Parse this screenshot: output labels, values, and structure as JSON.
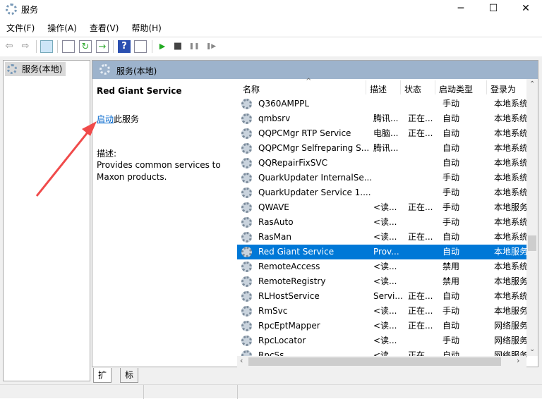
{
  "window": {
    "title": "服务",
    "minimize": "─",
    "maximize": "☐",
    "close": "✕"
  },
  "menu": [
    "文件(F)",
    "操作(A)",
    "查看(V)",
    "帮助(H)"
  ],
  "toolbar": {
    "back": "⇦",
    "forward": "⇨",
    "help": "?",
    "play": "▶",
    "stop": "■",
    "pause": "❚❚",
    "resume": "❚▶"
  },
  "tree": {
    "item": "服务(本地)"
  },
  "panel": {
    "header": "服务(本地)",
    "service_name": "Red Giant Service",
    "start_link": "启动",
    "start_suffix": "此服务",
    "desc_label": "描述:",
    "desc_text": "Provides common services to Maxon products."
  },
  "columns": [
    "名称",
    "描述",
    "状态",
    "启动类型",
    "登录为"
  ],
  "rows": [
    [
      "Q360AMPPL",
      "",
      "",
      "手动",
      "本地系统"
    ],
    [
      "qmbsrv",
      "腾讯...",
      "正在...",
      "自动",
      "本地系统"
    ],
    [
      "QQPCMgr RTP Service",
      "电脑...",
      "正在...",
      "自动",
      "本地系统"
    ],
    [
      "QQPCMgr Selfreparing S...",
      "腾讯...",
      "",
      "自动",
      "本地系统"
    ],
    [
      "QQRepairFixSVC",
      "",
      "",
      "自动",
      "本地系统"
    ],
    [
      "QuarkUpdater InternalSe...",
      "",
      "",
      "手动",
      "本地系统"
    ],
    [
      "QuarkUpdater Service 1....",
      "",
      "",
      "手动",
      "本地系统"
    ],
    [
      "QWAVE",
      "<读...",
      "正在...",
      "手动",
      "本地服务"
    ],
    [
      "RasAuto",
      "<读...",
      "",
      "手动",
      "本地系统"
    ],
    [
      "RasMan",
      "<读...",
      "正在...",
      "自动",
      "本地系统"
    ],
    [
      "Red Giant Service",
      "Prov...",
      "",
      "自动",
      "本地服务"
    ],
    [
      "RemoteAccess",
      "<读...",
      "",
      "禁用",
      "本地系统"
    ],
    [
      "RemoteRegistry",
      "<读...",
      "",
      "禁用",
      "本地服务"
    ],
    [
      "RLHostService",
      "Servi...",
      "正在...",
      "自动",
      "本地系统"
    ],
    [
      "RmSvc",
      "<读...",
      "正在...",
      "手动",
      "本地服务"
    ],
    [
      "RpcEptMapper",
      "<读...",
      "正在...",
      "自动",
      "网络服务"
    ],
    [
      "RpcLocator",
      "<读...",
      "",
      "手动",
      "网络服务"
    ],
    [
      "RpcSs",
      "<读...",
      "正在...",
      "自动",
      "网络服务"
    ]
  ],
  "selected_row": 10,
  "tabs": [
    "扩展",
    "标准"
  ],
  "colors": {
    "selection": "#0078d7",
    "header": "#9db3cc",
    "arrow": "#f04a4a"
  }
}
